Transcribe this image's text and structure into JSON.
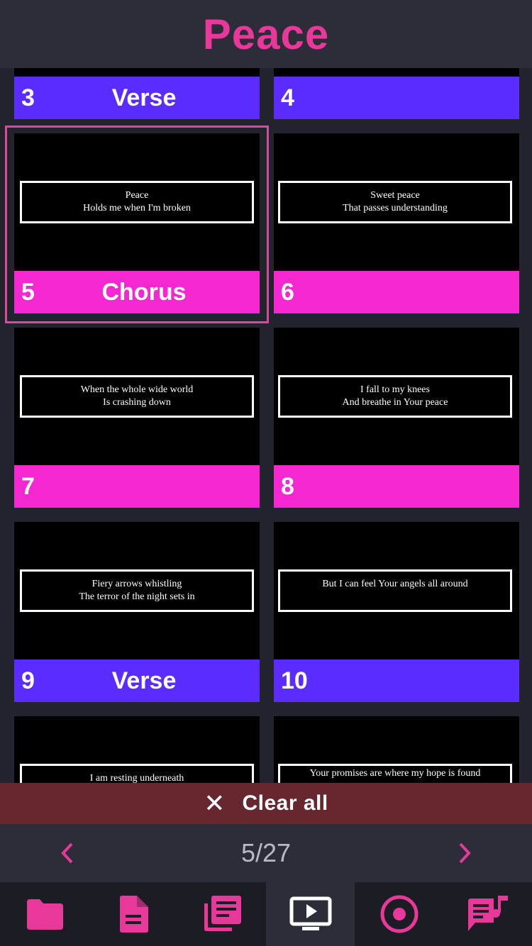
{
  "header": {
    "title": "Peace"
  },
  "slides": [
    {
      "number": "3",
      "section": "Verse",
      "lines": [],
      "bar_color": "verse"
    },
    {
      "number": "4",
      "section": "",
      "lines": [],
      "bar_color": "verse"
    },
    {
      "number": "5",
      "section": "Chorus",
      "lines": [
        "Peace",
        "Holds me when I'm broken"
      ],
      "bar_color": "chorus",
      "selected": true
    },
    {
      "number": "6",
      "section": "",
      "lines": [
        "Sweet peace",
        "That passes understanding"
      ],
      "bar_color": "chorus"
    },
    {
      "number": "7",
      "section": "",
      "lines": [
        "When the whole wide world",
        "Is crashing down"
      ],
      "bar_color": "chorus"
    },
    {
      "number": "8",
      "section": "",
      "lines": [
        "I fall to my knees",
        "And breathe in Your peace"
      ],
      "bar_color": "chorus"
    },
    {
      "number": "9",
      "section": "Verse",
      "lines": [
        "Fiery arrows whistling",
        "The terror of the night sets in"
      ],
      "bar_color": "verse"
    },
    {
      "number": "10",
      "section": "",
      "lines": [
        "But I can feel Your angels all around"
      ],
      "bar_color": "verse"
    },
    {
      "number": "",
      "section": "",
      "lines": [
        "I am resting underneath"
      ],
      "bar_color": "verse"
    },
    {
      "number": "",
      "section": "",
      "lines": [
        "Your promises are where my hope is found"
      ],
      "bar_color": "verse"
    }
  ],
  "clear": {
    "label": "Clear all",
    "icon": "close-icon"
  },
  "pager": {
    "current": "5/27",
    "prev_icon": "chevron-left-icon",
    "next_icon": "chevron-right-icon"
  },
  "tabs": [
    {
      "icon": "folder-icon",
      "active": false
    },
    {
      "icon": "document-icon",
      "active": false
    },
    {
      "icon": "library-icon",
      "active": false
    },
    {
      "icon": "presentation-icon",
      "active": true
    },
    {
      "icon": "record-icon",
      "active": false
    },
    {
      "icon": "song-lyrics-icon",
      "active": false
    }
  ],
  "colors": {
    "accent": "#e8389a",
    "verse": "#5a2cff",
    "chorus": "#f427d0",
    "clear_bg": "#66272e"
  }
}
